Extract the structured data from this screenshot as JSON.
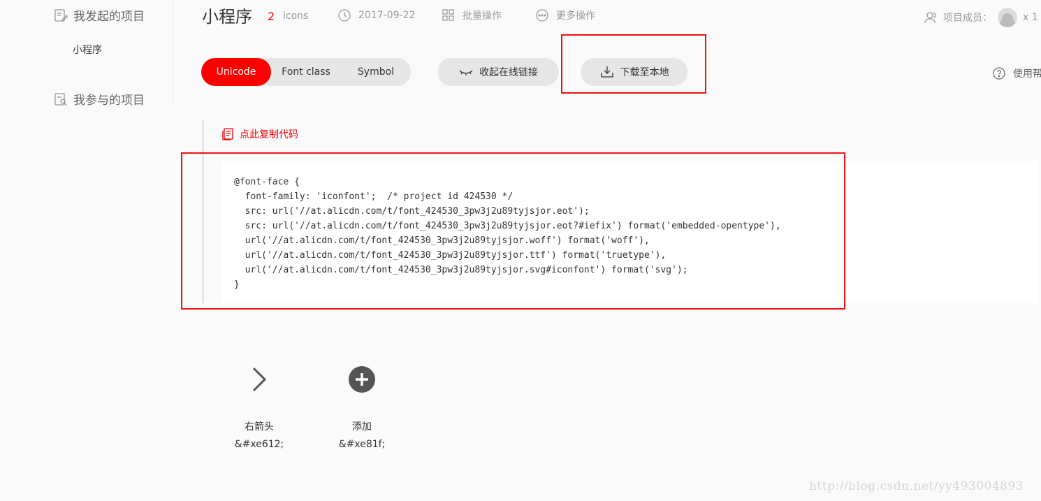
{
  "sidebar": {
    "my_projects_label": "我发起的项目",
    "project_item": "小程序",
    "joined_projects_label": "我参与的项目"
  },
  "header": {
    "title": "小程序",
    "icon_count": "2",
    "icon_count_label": "icons",
    "date": "2017-09-22",
    "batch_label": "批量操作",
    "more_label": "更多操作",
    "members_label": "项目成员：",
    "members_count": "x 1"
  },
  "tabs": [
    "Unicode",
    "Font class",
    "Symbol"
  ],
  "actions": {
    "collapse_label": "收起在线链接",
    "download_label": "下载至本地",
    "help_label": "使用帮助"
  },
  "code_panel": {
    "copy_label": "点此复制代码",
    "code": "@font-face {\n  font-family: 'iconfont';  /* project id 424530 */\n  src: url('//at.alicdn.com/t/font_424530_3pw3j2u89tyjsjor.eot');\n  src: url('//at.alicdn.com/t/font_424530_3pw3j2u89tyjsjor.eot?#iefix') format('embedded-opentype'),\n  url('//at.alicdn.com/t/font_424530_3pw3j2u89tyjsjor.woff') format('woff'),\n  url('//at.alicdn.com/t/font_424530_3pw3j2u89tyjsjor.ttf') format('truetype'),\n  url('//at.alicdn.com/t/font_424530_3pw3j2u89tyjsjor.svg#iconfont') format('svg');\n}"
  },
  "icons": [
    {
      "name": "右箭头",
      "code": "&#xe612;",
      "icon": "chevron-right-icon"
    },
    {
      "name": "添加",
      "code": "&#xe81f;",
      "icon": "plus-circle-icon"
    }
  ],
  "colors": {
    "accent": "#ff0000",
    "highlight_border": "#e11111",
    "pill_bg": "#e6e6e6"
  },
  "watermark": "http://blog.csdn.net/yy493004893"
}
